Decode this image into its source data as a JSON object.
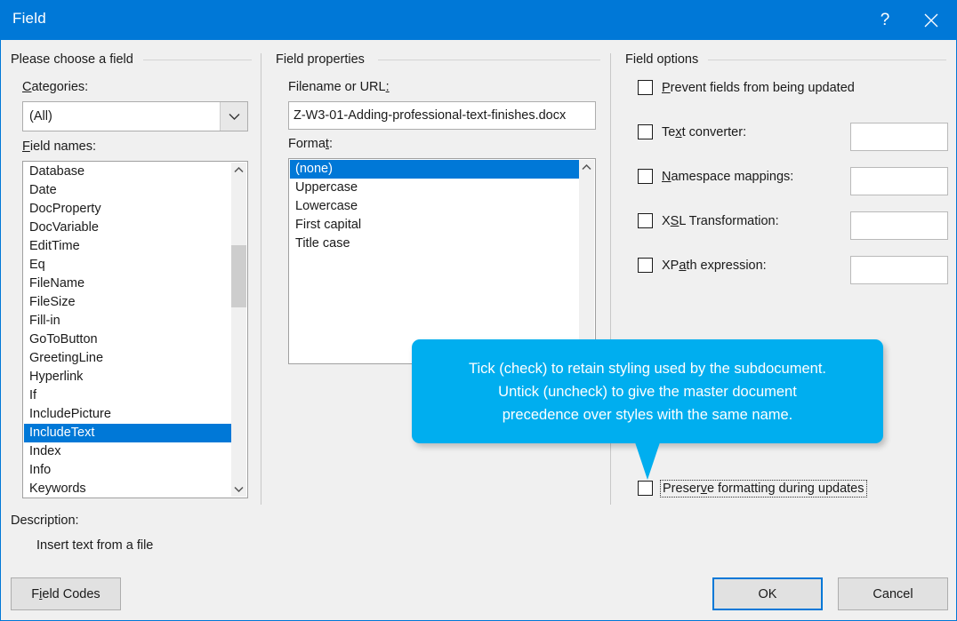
{
  "window": {
    "title": "Field",
    "help_icon": "question-mark-icon",
    "close_icon": "close-icon",
    "accent_color": "#0078d7",
    "background_color": "#f0f0f0"
  },
  "choose_field": {
    "group_title": "Please choose a field",
    "categories_label": "Categories:",
    "categories_accel": "C",
    "categories_value": "(All)",
    "categories_options": [
      "(All)"
    ],
    "field_names_label": "Field names:",
    "field_names_accel": "F",
    "field_names": [
      "Database",
      "Date",
      "DocProperty",
      "DocVariable",
      "EditTime",
      "Eq",
      "FileName",
      "FileSize",
      "Fill-in",
      "GoToButton",
      "GreetingLine",
      "Hyperlink",
      "If",
      "IncludePicture",
      "IncludeText",
      "Index",
      "Info",
      "Keywords"
    ],
    "selected_field": "IncludeText",
    "description_label": "Description:",
    "description_value": "Insert text from a file"
  },
  "field_properties": {
    "group_title": "Field properties",
    "filename_label": "Filename or URL:",
    "filename_value": "Z-W3-01-Adding-professional-text-finishes.docx",
    "format_label": "Format:",
    "format_accel": "t",
    "format_options": [
      "(none)",
      "Uppercase",
      "Lowercase",
      "First capital",
      "Title case"
    ],
    "format_selected": "(none)"
  },
  "field_options": {
    "group_title": "Field options",
    "items": [
      {
        "label": "Prevent fields from being updated",
        "accel": "P",
        "checked": false,
        "has_textbox": false,
        "value": ""
      },
      {
        "label": "Text converter:",
        "accel": "x",
        "checked": false,
        "has_textbox": true,
        "value": ""
      },
      {
        "label": "Namespace mappings:",
        "accel": "N",
        "checked": false,
        "has_textbox": true,
        "value": ""
      },
      {
        "label": "XSL Transformation:",
        "accel": "S",
        "checked": false,
        "has_textbox": true,
        "value": ""
      },
      {
        "label": "XPath expression:",
        "accel": "a",
        "checked": false,
        "has_textbox": true,
        "value": ""
      }
    ],
    "preserve": {
      "label": "Preserve formatting during updates",
      "accel": "v",
      "checked": false,
      "focused": true
    }
  },
  "callout": {
    "line1": "Tick (check) to retain styling used by the subdocument.",
    "line2": "Untick (uncheck) to give the master document",
    "line3": "precedence over styles with the same name.",
    "color": "#00aeef",
    "text_color": "#ffffff"
  },
  "buttons": {
    "field_codes": "Field Codes",
    "field_codes_accel": "i",
    "ok": "OK",
    "cancel": "Cancel"
  }
}
